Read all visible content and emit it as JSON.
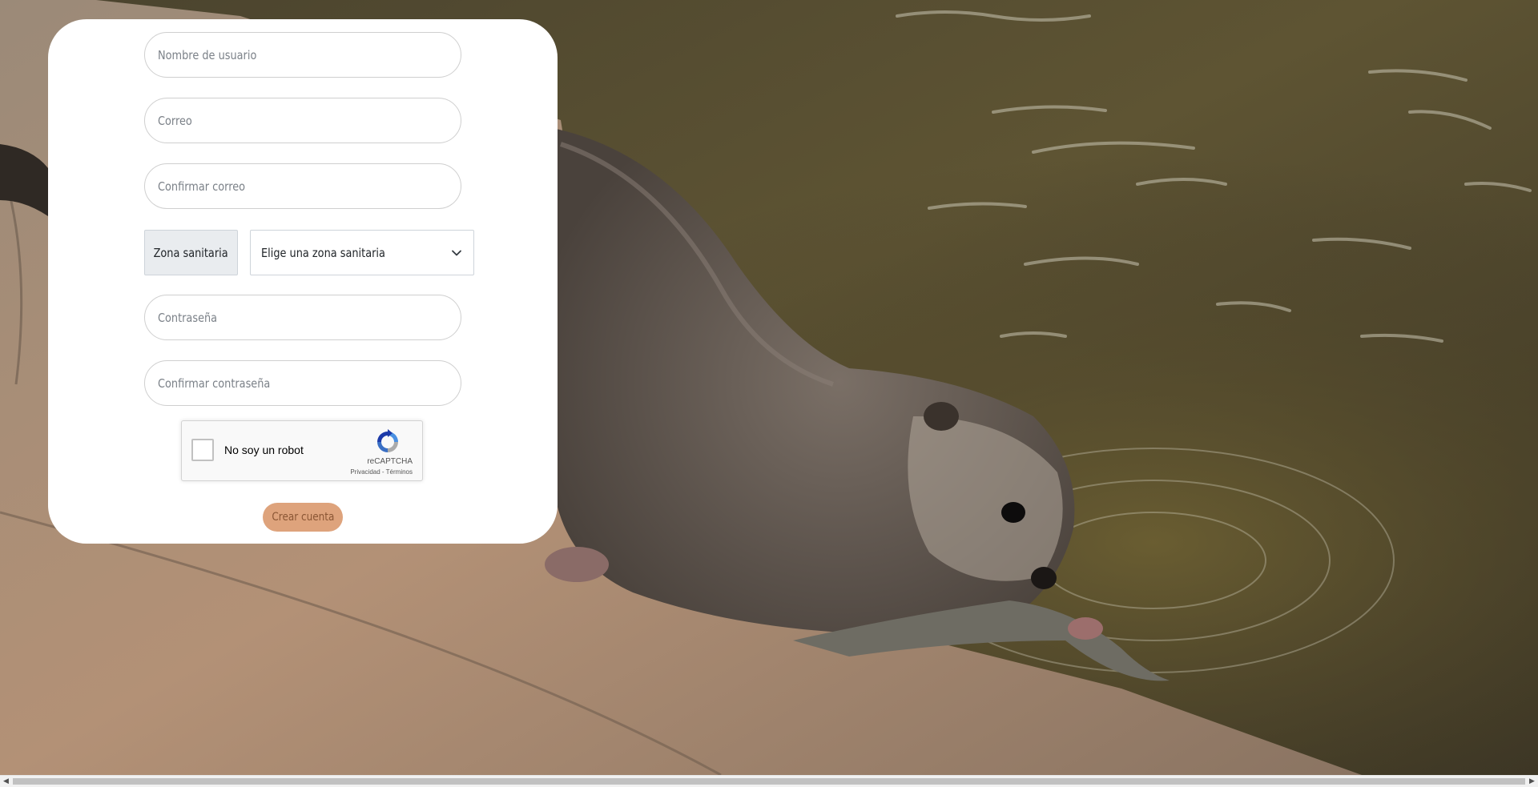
{
  "form": {
    "username_placeholder": "Nombre de usuario",
    "email_placeholder": "Correo",
    "confirm_email_placeholder": "Confirmar correo",
    "zone_label": "Zona sanitaria",
    "zone_select_value": "Elige una zona sanitaria",
    "password_placeholder": "Contraseña",
    "confirm_password_placeholder": "Confirmar contraseña",
    "create_account_label": "Crear cuenta"
  },
  "captcha": {
    "checkbox_label": "No soy un robot",
    "brand": "reCAPTCHA",
    "privacy_link": "Privacidad",
    "separator": "-",
    "terms_link": "Términos"
  },
  "icons": {
    "select_arrow": "chevron-down-icon",
    "recaptcha_logo": "recaptcha-icon",
    "scroll_left": "scroll-left-arrow-icon",
    "scroll_right": "scroll-right-arrow-icon"
  },
  "colors": {
    "card_background": "#ffffff",
    "create_button": "#dea37c",
    "create_button_text": "#8a5634",
    "input_border": "#cfcfcf",
    "zone_label_bg": "#e9ecef"
  }
}
